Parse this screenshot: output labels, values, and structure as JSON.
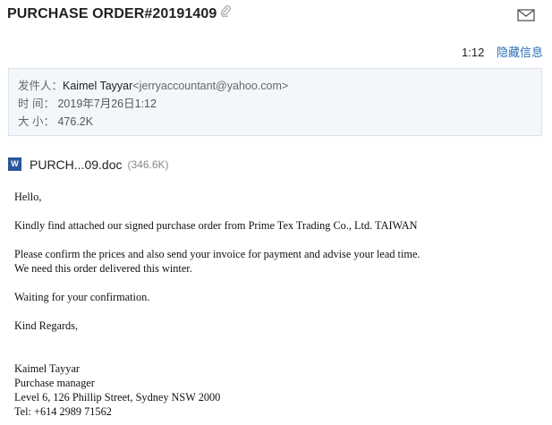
{
  "email": {
    "subject": "PURCHASE ORDER#20191409",
    "time": "1:12",
    "hide_info_label": "隐藏信息",
    "sender_label": "发件人：",
    "sender_name": "Kaimel Tayyar",
    "sender_email": "<jerryaccountant@yahoo.com>",
    "time_label": "时 间：",
    "date_value": "2019年7月26日1:12",
    "size_label": "大 小：",
    "size_value": "476.2K"
  },
  "attachment": {
    "icon_letter": "W",
    "name": "PURCH...09.doc",
    "size": "(346.6K)"
  },
  "body": {
    "greeting": "Hello,",
    "line1": "Kindly find attached our signed purchase order from Prime Tex Trading Co., Ltd. TAIWAN",
    "line2": "Please confirm the prices and also send your invoice for payment and advise your lead time.",
    "line3": "We need this order delivered this winter.",
    "line4": "Waiting for your confirmation.",
    "closing": "Kind Regards,",
    "sig_name": "Kaimel Tayyar",
    "sig_title": "Purchase manager",
    "sig_address": "Level 6, 126 Phillip Street, Sydney NSW 2000",
    "sig_tel": "Tel: +614 2989 71562"
  },
  "icons": {
    "paperclip": "paperclip-icon",
    "mail": "mail-icon",
    "word": "word-doc-icon"
  },
  "colors": {
    "link": "#2a6fb8",
    "info_bg": "#f4f7fa",
    "info_border": "#dbe2ea",
    "word_blue": "#2b579a"
  }
}
